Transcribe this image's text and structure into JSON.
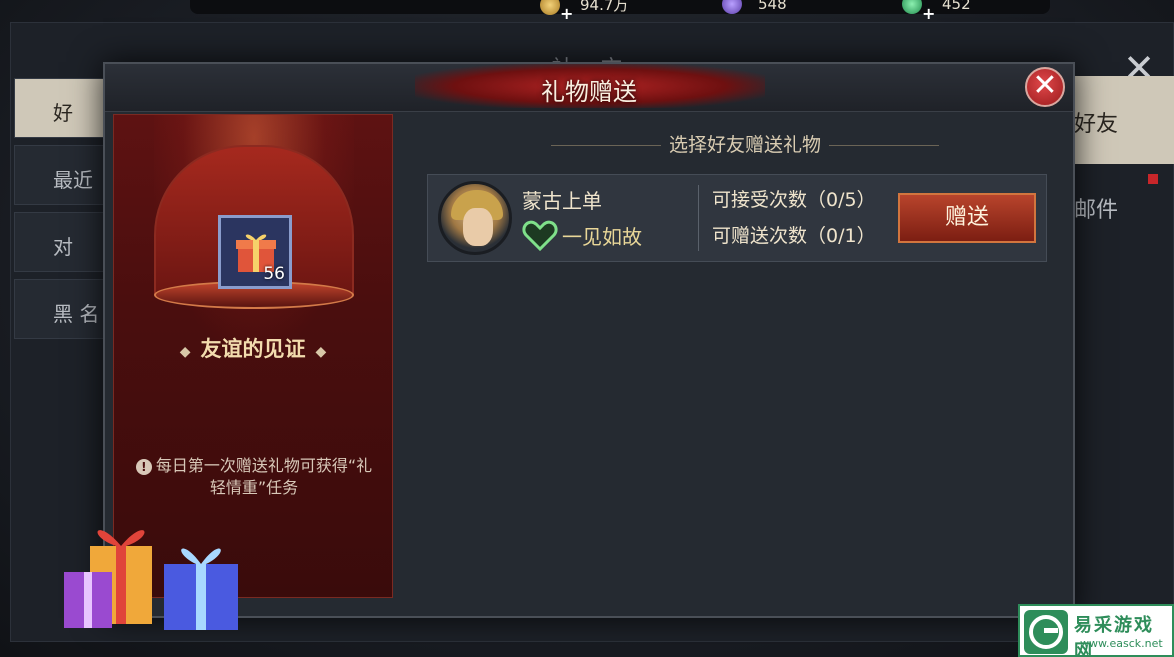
{
  "currencies": [
    {
      "icon": "gold-coin-icon",
      "value": "94.7万"
    },
    {
      "icon": "purple-gem-icon",
      "value": "548"
    },
    {
      "icon": "green-gem-icon",
      "value": "452"
    }
  ],
  "social": {
    "title": "社 交",
    "left_tabs": [
      "好",
      "最近",
      "对",
      "黑 名"
    ],
    "right_tabs": [
      "好友",
      "邮件"
    ]
  },
  "dialog": {
    "title": "礼物赠送",
    "gift": {
      "name": "友谊的见证",
      "count": "56",
      "tip": "每日第一次赠送礼物可获得“礼轻情重”任务"
    },
    "list_title": "选择好友赠送礼物",
    "friends": [
      {
        "name": "蒙古上单",
        "relation": "一见如故",
        "receive_count": "可接受次数（0/5）",
        "send_count": "可赠送次数（0/1）",
        "send_label": "赠送"
      }
    ]
  },
  "watermark": {
    "name": "易采游戏网",
    "url": "www.easck.net"
  },
  "colors": {
    "accent_red": "#b42424",
    "gold_text": "#f2dcae",
    "relation_green": "#7fe08a"
  }
}
